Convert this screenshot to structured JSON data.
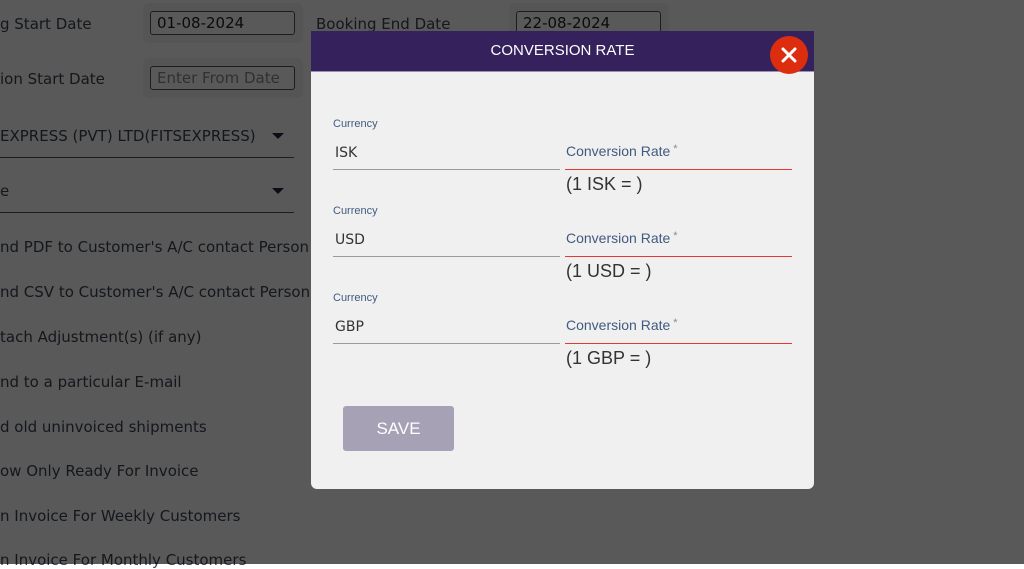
{
  "background_form": {
    "booking_start_label": "g Start Date",
    "booking_start_value": "01-08-2024",
    "booking_end_label": "Booking End Date",
    "booking_end_value": "22-08-2024",
    "collection_start_label": "ion Start Date",
    "collection_start_placeholder": "Enter From Date",
    "customer_select_value": "EXPRESS (PVT) LTD(FITSEXPRESS)",
    "second_select_value": "e",
    "options": [
      "nd PDF to Customer's A/C contact Person",
      "nd CSV to Customer's A/C contact Person",
      "tach Adjustment(s) (if any)",
      "nd to a particular E-mail",
      "d old uninvoiced shipments",
      "ow Only Ready For Invoice",
      "n Invoice For Weekly Customers",
      "n Invoice For Monthly Customers"
    ]
  },
  "modal": {
    "title": "CONVERSION RATE",
    "close_icon": "close-icon",
    "rows": [
      {
        "currency_label": "Currency",
        "currency_value": "ISK",
        "rate_label": "Conversion Rate",
        "required_mark": "*",
        "rate_value": "",
        "hint": "(1 ISK = )"
      },
      {
        "currency_label": "Currency",
        "currency_value": "USD",
        "rate_label": "Conversion Rate",
        "required_mark": "*",
        "rate_value": "",
        "hint": "(1 USD = )"
      },
      {
        "currency_label": "Currency",
        "currency_value": "GBP",
        "rate_label": "Conversion Rate",
        "required_mark": "*",
        "rate_value": "",
        "hint": "(1 GBP = )"
      }
    ],
    "save_label": "SAVE"
  },
  "colors": {
    "header": "#35215c",
    "close_button": "#dc2e0e",
    "save_button_disabled": "#a7a1b6",
    "error_underline": "#e53935",
    "label_blue": "#415a80"
  }
}
